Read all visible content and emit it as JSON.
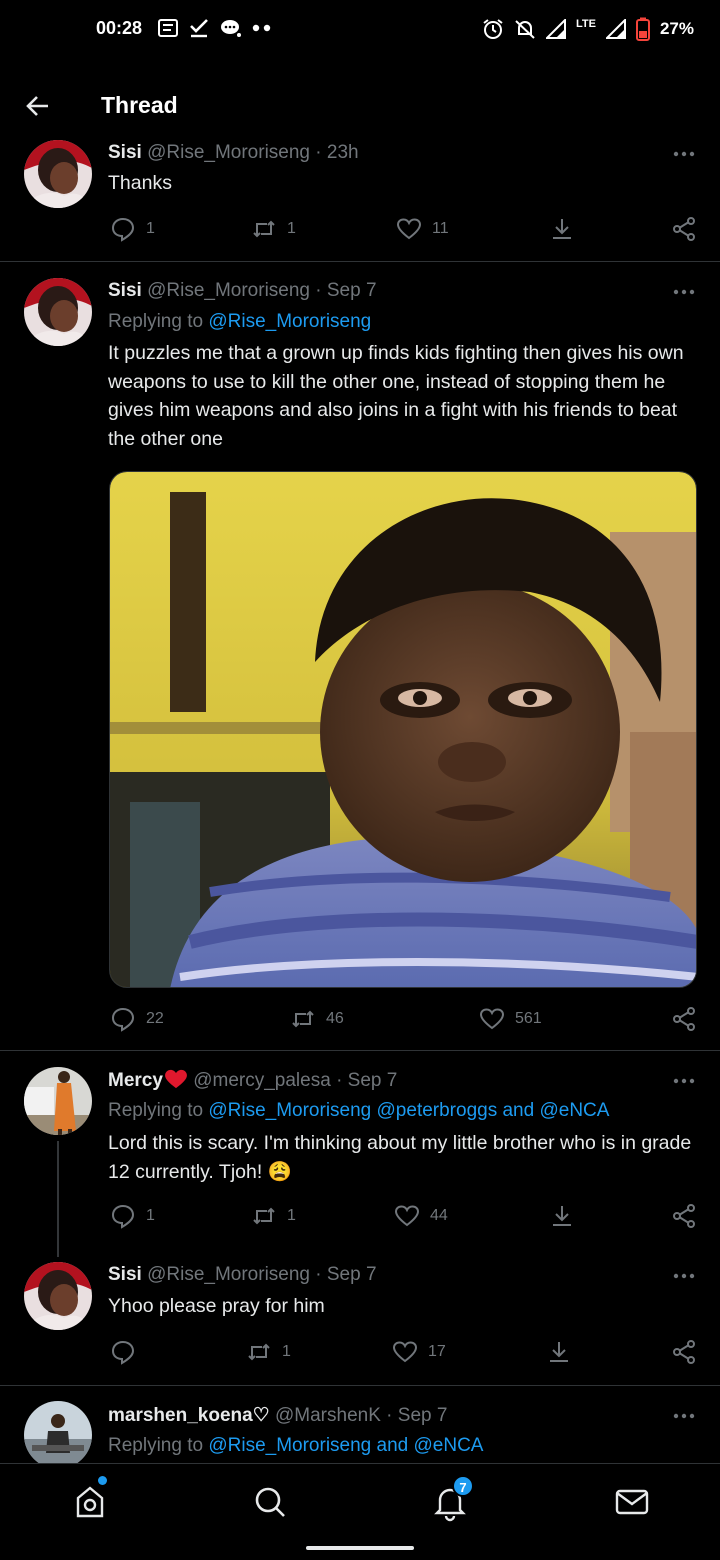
{
  "status_bar": {
    "time": "00:28",
    "battery": "27%",
    "network": "LTE"
  },
  "header": {
    "title": "Thread"
  },
  "tweets": [
    {
      "name": "Sisi",
      "handle": "@Rise_Mororiseng",
      "time": "· 23h",
      "text": "Thanks",
      "replies": "1",
      "retweets": "1",
      "likes": "11"
    },
    {
      "name": "Sisi",
      "handle": "@Rise_Mororiseng",
      "time": "· Sep 7",
      "replying_prefix": "Replying to",
      "replying_to": "@Rise_Mororiseng",
      "text": "It puzzles me that a grown up finds kids fighting then gives his own weapons to use to kill the other one, instead of stopping them he gives him weapons and also joins in a fight with his friends to beat the other one",
      "replies": "22",
      "retweets": "46",
      "likes": "561"
    },
    {
      "name": "Mercy",
      "handle": "@mercy_palesa",
      "time": "· Sep 7",
      "replying_prefix": "Replying to",
      "replying_to": "@Rise_Mororiseng @peterbroggs and @eNCA",
      "text": "Lord this is scary. I'm thinking about my little brother who is in grade 12 currently. Tjoh! 😩",
      "replies": "1",
      "retweets": "1",
      "likes": "44"
    },
    {
      "name": "Sisi",
      "handle": "@Rise_Mororiseng",
      "time": "· Sep 7",
      "text": "Yhoo please pray for him",
      "replies": "",
      "retweets": "1",
      "likes": "17"
    },
    {
      "name": "marshen_koena♡",
      "handle": "@MarshenK",
      "time": "· Sep 7",
      "replying_prefix": "Replying to",
      "replying_to": "@Rise_Mororiseng and @eNCA"
    }
  ],
  "bottom_nav": {
    "notification_count": "7"
  },
  "colors": {
    "background": "#000000",
    "text": "#e7e9ea",
    "muted": "#71767b",
    "accent": "#1d9bf0",
    "divider": "#2f3336"
  }
}
